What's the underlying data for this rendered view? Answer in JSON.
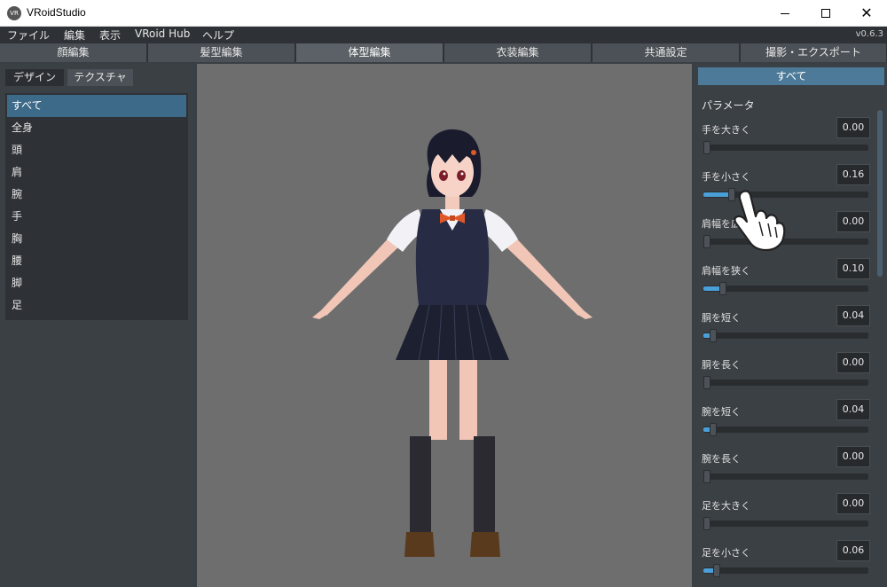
{
  "window": {
    "title": "VRoidStudio",
    "icon_text": "VR"
  },
  "menu": {
    "items": [
      "ファイル",
      "編集",
      "表示",
      "VRoid Hub",
      "ヘルプ"
    ],
    "version": "v0.6.3"
  },
  "main_tabs": [
    "顔編集",
    "髪型編集",
    "体型編集",
    "衣装編集",
    "共通設定",
    "撮影・エクスポート"
  ],
  "active_main_tab": "体型編集",
  "left_panel": {
    "tabs": [
      "デザイン",
      "テクスチャ"
    ],
    "categories": [
      "すべて",
      "全身",
      "頭",
      "肩",
      "腕",
      "手",
      "胸",
      "腰",
      "脚",
      "足"
    ],
    "selected_category": "すべて"
  },
  "right_panel": {
    "header": "すべて",
    "section_title": "パラメータ",
    "params": [
      {
        "label": "手を大きく",
        "value": "0.00",
        "level": 0.0
      },
      {
        "label": "手を小さく",
        "value": "0.16",
        "level": 0.16
      },
      {
        "label": "肩幅を広",
        "value": "0.00",
        "level": 0.0
      },
      {
        "label": "肩幅を狭く",
        "value": "0.10",
        "level": 0.1
      },
      {
        "label": "胴を短く",
        "value": "0.04",
        "level": 0.04
      },
      {
        "label": "胴を長く",
        "value": "0.00",
        "level": 0.0
      },
      {
        "label": "腕を短く",
        "value": "0.04",
        "level": 0.04
      },
      {
        "label": "腕を長く",
        "value": "0.00",
        "level": 0.0
      },
      {
        "label": "足を大きく",
        "value": "0.00",
        "level": 0.0
      },
      {
        "label": "足を小さく",
        "value": "0.06",
        "level": 0.06
      }
    ]
  },
  "colors": {
    "accent": "#4a9fd8",
    "selection": "#3e6a8a",
    "header": "#4d7a98",
    "viewport": "#6e6e6e",
    "skirt": "#1d2030",
    "vest": "#272b44",
    "bow": "#e0582a"
  }
}
